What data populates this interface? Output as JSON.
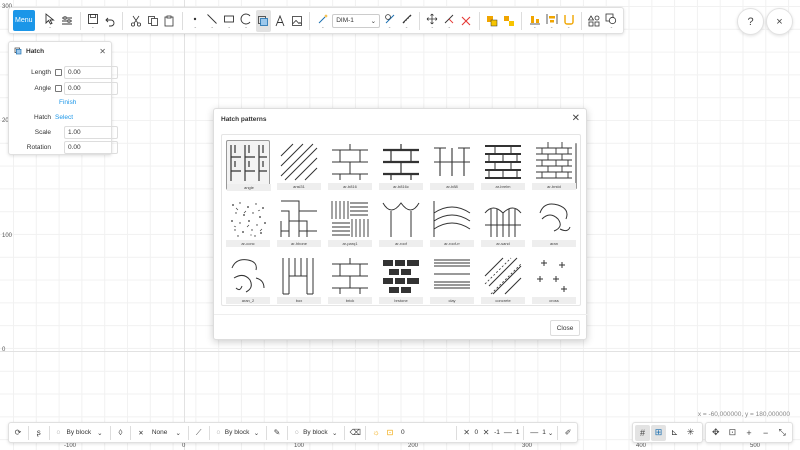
{
  "toolbar": {
    "menu_label": "Menu",
    "dimension_style": "DIM-1"
  },
  "top_right": {
    "help_symbol": "?",
    "close_symbol": "×"
  },
  "canvas": {
    "y_labels": [
      "300",
      "200",
      "100",
      "0"
    ],
    "x_labels": [
      "-100",
      "0",
      "100",
      "200",
      "300",
      "400",
      "500"
    ],
    "coordinates": "x = -60,000000, y = 180,000000"
  },
  "hatch_panel": {
    "title": "Hatch",
    "length_label": "Length",
    "length_value": "0.00",
    "angle_label": "Angle",
    "angle_value": "0.00",
    "finish_label": "Finish",
    "hatch_label": "Hatch",
    "hatch_select": "Select",
    "scale_label": "Scale",
    "scale_value": "1.00",
    "rotation_label": "Rotation",
    "rotation_value": "0.00"
  },
  "modal": {
    "title": "Hatch patterns",
    "close_button": "Close",
    "patterns": [
      "angle",
      "ansi31",
      "ar-b816",
      "ar-b816c",
      "ar-b88",
      "ar-brelm",
      "ar-brstd",
      "ar-conc",
      "ar-hbone",
      "ar-parq1",
      "ar-roof",
      "ar-roof-rr",
      "ar-sand",
      "aran",
      "aran_2",
      "box",
      "brick",
      "brstone",
      "clay",
      "concrete",
      "cross"
    ],
    "selected": "angle"
  },
  "bottombar": {
    "layer_color": "By block",
    "line_type": "None",
    "line_weight": "By block",
    "transparency": "By block",
    "layer_value": "0",
    "x_value": "0",
    "y_value": "-1",
    "line_one": "1",
    "line_two": "1"
  }
}
